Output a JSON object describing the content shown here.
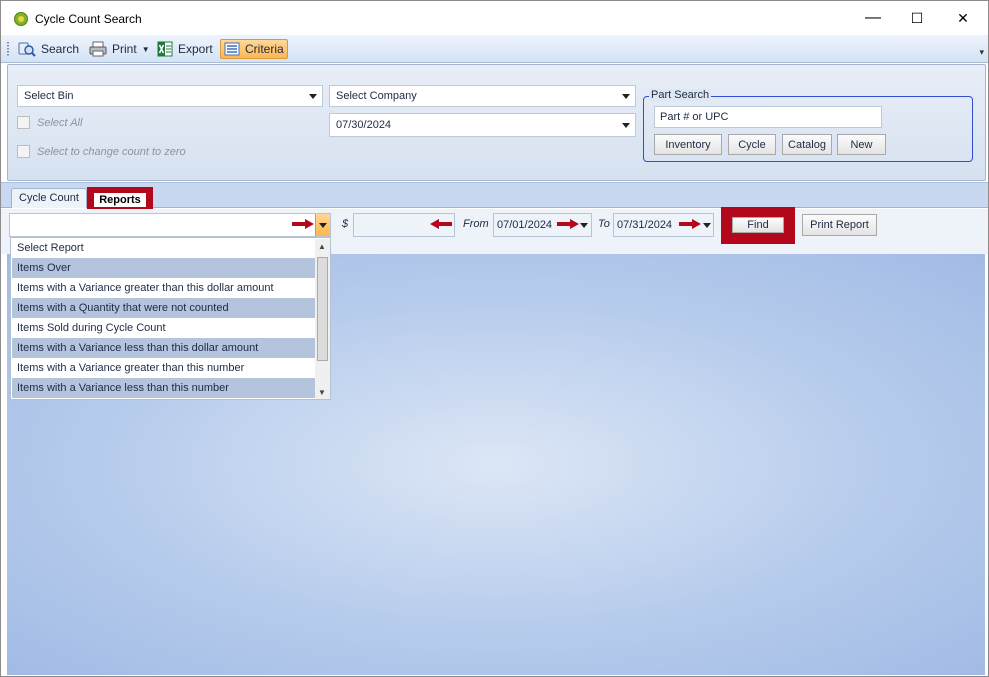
{
  "window": {
    "title": "Cycle Count Search",
    "controls": {
      "minimize": "—",
      "maximize": "☐",
      "close": "✕"
    }
  },
  "toolbar": {
    "search": "Search",
    "print": "Print",
    "export": "Export",
    "criteria": "Criteria"
  },
  "criteria": {
    "bin_select": "Select Bin",
    "company_select": "Select Company",
    "date": "07/30/2024",
    "select_all": "Select All",
    "zero_count": "Select to change count to zero",
    "part_search": {
      "legend": "Part Search",
      "placeholder": "Part # or UPC",
      "buttons": [
        "Inventory",
        "Cycle",
        "Catalog",
        "New"
      ]
    }
  },
  "tabs": {
    "cycle_count": "Cycle Count",
    "reports": "Reports"
  },
  "report_bar": {
    "report_value": "",
    "dollar_label": "$",
    "amount_value": "",
    "from_label": "From",
    "from_date": "07/01/2024",
    "to_label": "To",
    "to_date": "07/31/2024",
    "find": "Find",
    "print_report": "Print Report"
  },
  "report_options": [
    "Select Report",
    "Items Over",
    "Items with a Variance greater than this dollar amount",
    "Items with a Quantity that were not counted",
    "Items Sold during Cycle Count",
    "Items with a Variance less than this dollar amount",
    "Items with a Variance greater than this number",
    "Items with a Variance less than this number"
  ],
  "colors": {
    "highlight": "#b3071b",
    "active_tool": "#ffb74f",
    "list_alt_row": "#b3c4dc",
    "content_bg": "#b7ccec"
  }
}
